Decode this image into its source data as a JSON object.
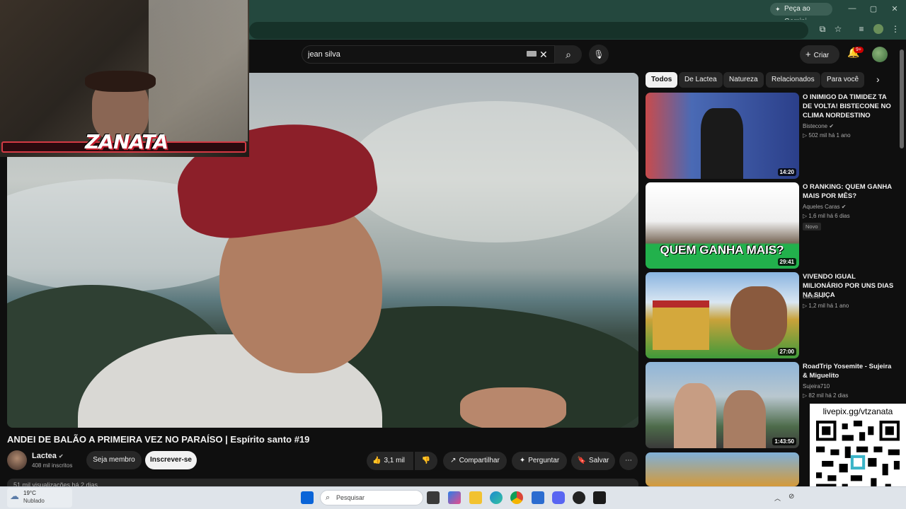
{
  "browser": {
    "gemini_label": "Peça ao Gemini",
    "window_buttons": [
      "—",
      "▢",
      "✕"
    ]
  },
  "youtube": {
    "search_value": "jean silva",
    "create_label": "Criar",
    "notifications_badge": "9+"
  },
  "overlay": {
    "streamer_logo": "ZANATA",
    "livepix": "livepix.gg/vtzanata"
  },
  "video": {
    "title": "ANDEI DE BALÃO A PRIMEIRA VEZ NO PARAÍSO | Espírito santo #19",
    "channel": "Lactea",
    "subscribers": "408 mil inscritos",
    "member_label": "Seja membro",
    "subscribe_label": "Inscrever-se",
    "likes": "3,1 mil",
    "share_label": "Compartilhar",
    "ask_label": "Perguntar",
    "save_label": "Salvar",
    "views_line": "51 mil visualizações  há 2 dias"
  },
  "chips": [
    "Todos",
    "De Lactea",
    "Natureza",
    "Relacionados",
    "Para você"
  ],
  "recommendations": [
    {
      "title": "O INIMIGO DA TIMIDEZ TA DE VOLTA! BISTECONE NO CLIMA NORDESTINO",
      "channel": "Bistecone",
      "meta": "▷ 502 mil  há 1 ano",
      "duration": "14:20",
      "badge": ""
    },
    {
      "title": "O RANKING: QUEM GANHA MAIS POR MÊS?",
      "channel": "Aqueles Caras",
      "meta": "▷ 1,6 mil  há 6 dias",
      "duration": "29:41",
      "badge": "Novo",
      "thumb_text": "QUEM GANHA MAIS?"
    },
    {
      "title": "VIVENDO IGUAL MILIONÁRIO POR UNS DIAS NA SUIÇA",
      "channel": "Lactea",
      "meta": "▷ 1,2 mil  há 1 ano",
      "duration": "27:00",
      "badge": ""
    },
    {
      "title": "RoadTrip Yosemite - Sujeira & Miguelito",
      "channel": "Sujeira710",
      "meta": "▷ 82 mil  há 2 dias",
      "duration": "1:43:50",
      "badge": ""
    }
  ],
  "taskbar": {
    "temperature": "19°C",
    "weather": "Nublado",
    "search_placeholder": "Pesquisar"
  },
  "colors": {
    "browser_chrome": "#24483e",
    "yt_background": "#0f0f0f",
    "accent_red": "#cc0000"
  }
}
